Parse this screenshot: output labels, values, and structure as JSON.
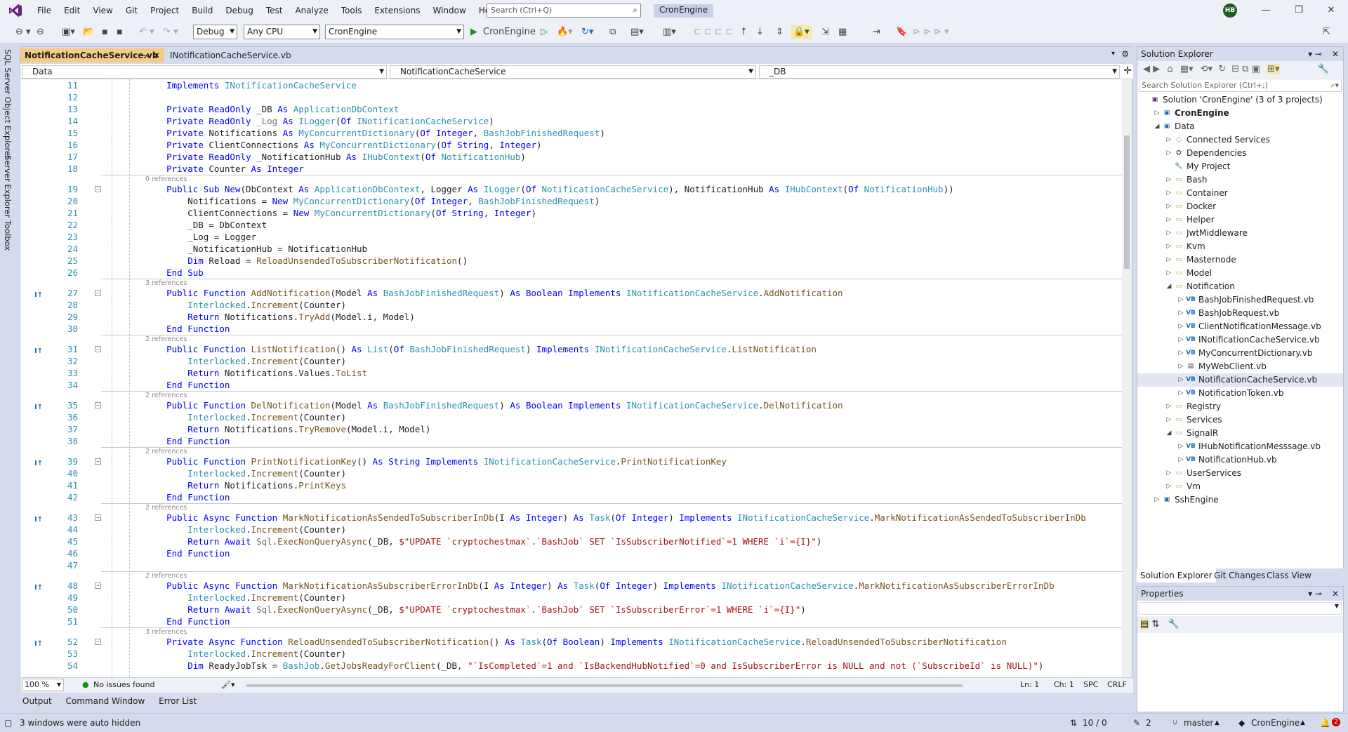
{
  "menu": [
    "File",
    "Edit",
    "View",
    "Git",
    "Project",
    "Build",
    "Debug",
    "Test",
    "Analyze",
    "Tools",
    "Extensions",
    "Window",
    "Help"
  ],
  "search": {
    "placeholder": "Search (Ctrl+Q)"
  },
  "solution_name": "CronEngine",
  "avatar": "HB",
  "toolbar": {
    "config": "Debug",
    "platform": "Any CPU",
    "startup": "CronEngine",
    "run_label": "CronEngine"
  },
  "side_tabs": [
    "SQL Server Object Explorer",
    "Server Explorer",
    "Toolbox"
  ],
  "doc_tabs": [
    {
      "label": "NotificationCacheService.vb",
      "active": true
    },
    {
      "label": "INotificationCacheService.vb",
      "active": false
    }
  ],
  "nav": {
    "project": "Data",
    "class": "NotificationCacheService",
    "member": "_DB"
  },
  "code_lines": [
    {
      "ln": "11",
      "ref": "",
      "html": "    <span class=kw>Implements</span> <span class=ty>INotificationCacheService</span>"
    },
    {
      "ln": "12",
      "ref": "",
      "html": ""
    },
    {
      "ln": "13",
      "ref": "",
      "html": "    <span class=kw>Private</span> <span class=kw>ReadOnly</span> _DB <span class=kw>As</span> <span class=ty>ApplicationDbContext</span>"
    },
    {
      "ln": "14",
      "ref": "",
      "html": "    <span class=kw>Private</span> <span class=kw>ReadOnly</span> <span class=gr>_Log</span> <span class=kw>As</span> <span class=ty>ILogger</span>(<span class=kw>Of</span> <span class=ty>INotificationCacheService</span>)"
    },
    {
      "ln": "15",
      "ref": "",
      "html": "    <span class=kw>Private</span> Notifications <span class=kw>As</span> <span class=ty>MyConcurrentDictionary</span>(<span class=kw>Of</span> <span class=kw>Integer</span>, <span class=ty>BashJobFinishedRequest</span>)"
    },
    {
      "ln": "16",
      "ref": "",
      "html": "    <span class=kw>Private</span> ClientConnections <span class=kw>As</span> <span class=ty>MyConcurrentDictionary</span>(<span class=kw>Of</span> <span class=kw>String</span>, <span class=kw>Integer</span>)"
    },
    {
      "ln": "17",
      "ref": "",
      "html": "    <span class=kw>Private</span> <span class=kw>ReadOnly</span> _NotificationHub <span class=kw>As</span> <span class=ty>IHubContext</span>(<span class=kw>Of</span> <span class=ty>NotificationHub</span>)"
    },
    {
      "ln": "18",
      "ref": "",
      "html": "    <span class=kw>Private</span> Counter <span class=kw>As</span> <span class=kw>Integer</span>"
    },
    {
      "ln": "19",
      "ref": "0 references",
      "html": "    <span class=kw>Public</span> <span class=kw>Sub</span> <span class=kw>New</span>(DbContext <span class=kw>As</span> <span class=ty>ApplicationDbContext</span>, Logger <span class=kw>As</span> <span class=ty>ILogger</span>(<span class=kw>Of</span> <span class=ty>NotificationCacheService</span>), NotificationHub <span class=kw>As</span> <span class=ty>IHubContext</span>(<span class=kw>Of</span> <span class=ty>NotificationHub</span>))"
    },
    {
      "ln": "20",
      "ref": "",
      "html": "        Notifications = <span class=kw>New</span> <span class=ty>MyConcurrentDictionary</span>(<span class=kw>Of</span> <span class=kw>Integer</span>, <span class=ty>BashJobFinishedRequest</span>)"
    },
    {
      "ln": "21",
      "ref": "",
      "html": "        ClientConnections = <span class=kw>New</span> <span class=ty>MyConcurrentDictionary</span>(<span class=kw>Of</span> <span class=kw>String</span>, <span class=kw>Integer</span>)"
    },
    {
      "ln": "22",
      "ref": "",
      "html": "        _DB = DbContext"
    },
    {
      "ln": "23",
      "ref": "",
      "html": "        _Log = Logger"
    },
    {
      "ln": "24",
      "ref": "",
      "html": "        _NotificationHub = NotificationHub"
    },
    {
      "ln": "25",
      "ref": "",
      "html": "        <span class=kw>Dim</span> Reload = <span class=mt>ReloadUnsendedToSubscriberNotification</span>()"
    },
    {
      "ln": "26",
      "ref": "",
      "html": "    <span class=kw>End</span> <span class=kw>Sub</span>"
    },
    {
      "ln": "27",
      "ref": "3 references",
      "html": "    <span class=kw>Public</span> <span class=kw>Function</span> <span class=mt>AddNotification</span>(Model <span class=kw>As</span> <span class=ty>BashJobFinishedRequest</span>) <span class=kw>As</span> <span class=kw>Boolean</span> <span class=kw>Implements</span> <span class=ty>INotificationCacheService</span>.<span class=mt>AddNotification</span>"
    },
    {
      "ln": "28",
      "ref": "",
      "html": "        <span class=ty>Interlocked</span>.<span class=mt>Increment</span>(Counter)"
    },
    {
      "ln": "29",
      "ref": "",
      "html": "        <span class=kw>Return</span> Notifications.<span class=mt>TryAdd</span>(Model.i, Model)"
    },
    {
      "ln": "30",
      "ref": "",
      "html": "    <span class=kw>End</span> <span class=kw>Function</span>"
    },
    {
      "ln": "31",
      "ref": "2 references",
      "html": "    <span class=kw>Public</span> <span class=kw>Function</span> <span class=mt>ListNotification</span>() <span class=kw>As</span> <span class=ty>List</span>(<span class=kw>Of</span> <span class=ty>BashJobFinishedRequest</span>) <span class=kw>Implements</span> <span class=ty>INotificationCacheService</span>.<span class=mt>ListNotification</span>"
    },
    {
      "ln": "32",
      "ref": "",
      "html": "        <span class=ty>Interlocked</span>.<span class=mt>Increment</span>(Counter)"
    },
    {
      "ln": "33",
      "ref": "",
      "html": "        <span class=kw>Return</span> Notifications.Values.<span class=mt>ToList</span>"
    },
    {
      "ln": "34",
      "ref": "",
      "html": "    <span class=kw>End</span> <span class=kw>Function</span>"
    },
    {
      "ln": "35",
      "ref": "2 references",
      "html": "    <span class=kw>Public</span> <span class=kw>Function</span> <span class=mt>DelNotification</span>(Model <span class=kw>As</span> <span class=ty>BashJobFinishedRequest</span>) <span class=kw>As</span> <span class=kw>Boolean</span> <span class=kw>Implements</span> <span class=ty>INotificationCacheService</span>.<span class=mt>DelNotification</span>"
    },
    {
      "ln": "36",
      "ref": "",
      "html": "        <span class=ty>Interlocked</span>.<span class=mt>Increment</span>(Counter)"
    },
    {
      "ln": "37",
      "ref": "",
      "html": "        <span class=kw>Return</span> Notifications.<span class=mt>TryRemove</span>(Model.i, Model)"
    },
    {
      "ln": "38",
      "ref": "",
      "html": "    <span class=kw>End</span> <span class=kw>Function</span>"
    },
    {
      "ln": "39",
      "ref": "2 references",
      "html": "    <span class=kw>Public</span> <span class=kw>Function</span> <span class=mt>PrintNotificationKey</span>() <span class=kw>As</span> <span class=kw>String</span> <span class=kw>Implements</span> <span class=ty>INotificationCacheService</span>.<span class=mt>PrintNotificationKey</span>"
    },
    {
      "ln": "40",
      "ref": "",
      "html": "        <span class=ty>Interlocked</span>.<span class=mt>Increment</span>(Counter)"
    },
    {
      "ln": "41",
      "ref": "",
      "html": "        <span class=kw>Return</span> Notifications.<span class=mt>PrintKeys</span>"
    },
    {
      "ln": "42",
      "ref": "",
      "html": "    <span class=kw>End</span> <span class=kw>Function</span>"
    },
    {
      "ln": "43",
      "ref": "2 references",
      "html": "    <span class=kw>Public</span> <span class=kw>Async</span> <span class=kw>Function</span> <span class=mt>MarkNotificationAsSendedToSubscriberInDb</span>(I <span class=kw>As</span> <span class=kw>Integer</span>) <span class=kw>As</span> <span class=ty>Task</span>(<span class=kw>Of</span> <span class=kw>Integer</span>) <span class=kw>Implements</span> <span class=ty>INotificationCacheService</span>.<span class=mt>MarkNotificationAsSendedToSubscriberInDb</span>"
    },
    {
      "ln": "44",
      "ref": "",
      "html": "        <span class=ty>Interlocked</span>.<span class=mt>Increment</span>(Counter)"
    },
    {
      "ln": "45",
      "ref": "",
      "html": "        <span class=kw>Return</span> <span class=kw>Await</span> <span class=gr>Sql</span>.<span class=mt>ExecNonQueryAsync</span>(_DB, <span class=st>$\"UPDATE `cryptochestmax`.`BashJob` SET `IsSubscriberNotified`=1 WHERE `i`={I}\"</span>)"
    },
    {
      "ln": "46",
      "ref": "",
      "html": "    <span class=kw>End</span> <span class=kw>Function</span>"
    },
    {
      "ln": "47",
      "ref": "",
      "html": ""
    },
    {
      "ln": "48",
      "ref": "2 references",
      "html": "    <span class=kw>Public</span> <span class=kw>Async</span> <span class=kw>Function</span> <span class=mt>MarkNotificationAsSubscriberErrorInDb</span>(I <span class=kw>As</span> <span class=kw>Integer</span>) <span class=kw>As</span> <span class=ty>Task</span>(<span class=kw>Of</span> <span class=kw>Integer</span>) <span class=kw>Implements</span> <span class=ty>INotificationCacheService</span>.<span class=mt>MarkNotificationAsSubscriberErrorInDb</span>"
    },
    {
      "ln": "49",
      "ref": "",
      "html": "        <span class=ty>Interlocked</span>.<span class=mt>Increment</span>(Counter)"
    },
    {
      "ln": "50",
      "ref": "",
      "html": "        <span class=kw>Return</span> <span class=kw>Await</span> <span class=gr>Sql</span>.<span class=mt>ExecNonQueryAsync</span>(_DB, <span class=st>$\"UPDATE `cryptochestmax`.`BashJob` SET `IsSubscriberError`=1 WHERE `i`={I}\"</span>)"
    },
    {
      "ln": "51",
      "ref": "",
      "html": "    <span class=kw>End</span> <span class=kw>Function</span>"
    },
    {
      "ln": "52",
      "ref": "3 references",
      "html": "    <span class=kw>Private</span> <span class=kw>Async</span> <span class=kw>Function</span> <span class=mt>ReloadUnsendedToSubscriberNotification</span>() <span class=kw>As</span> <span class=ty>Task</span>(<span class=kw>Of</span> <span class=kw>Boolean</span>) <span class=kw>Implements</span> <span class=ty>INotificationCacheService</span>.<span class=mt>ReloadUnsendedToSubscriberNotification</span>"
    },
    {
      "ln": "53",
      "ref": "",
      "html": "        <span class=ty>Interlocked</span>.<span class=mt>Increment</span>(Counter)"
    },
    {
      "ln": "54",
      "ref": "",
      "html": "        <span class=kw>Dim</span> ReadyJobTsk = <span class=ty>BashJob</span>.<span class=mt>GetJobsReadyForClient</span>(_DB, <span class=st>\"`IsCompleted`=1 and `IsBackendHubNotified`=0 and IsSubscriberError is NULL and not (`SubscribeId` is NULL)\"</span>)"
    }
  ],
  "editor_status": {
    "zoom": "100 %",
    "issues": "No issues found",
    "ln": "Ln: 1",
    "ch": "Ch: 1",
    "spc": "SPC",
    "crlf": "CRLF"
  },
  "bottom_tabs": [
    "Output",
    "Command Window",
    "Error List"
  ],
  "statusbar": {
    "left": "3 windows were auto hidden",
    "updown": "10 / 0",
    "pencil": "2",
    "branch": "master",
    "repo": "CronEngine",
    "bell": "2"
  },
  "solution_explorer": {
    "title": "Solution Explorer",
    "search_placeholder": "Search Solution Explorer (Ctrl+;)",
    "items": [
      {
        "label": "Solution 'CronEngine' (3 of 3 projects)",
        "level": 0,
        "exp": "",
        "icon": "sln"
      },
      {
        "label": "CronEngine",
        "level": 1,
        "exp": "▷",
        "icon": "proj",
        "bold": true
      },
      {
        "label": "Data",
        "level": 1,
        "exp": "◢",
        "icon": "proj"
      },
      {
        "label": "Connected Services",
        "level": 2,
        "exp": "▷",
        "icon": "svc"
      },
      {
        "label": "Dependencies",
        "level": 2,
        "exp": "▷",
        "icon": "dep"
      },
      {
        "label": "My Project",
        "level": 2,
        "exp": "",
        "icon": "wrench"
      },
      {
        "label": "Bash",
        "level": 2,
        "exp": "▷",
        "icon": "folder"
      },
      {
        "label": "Container",
        "level": 2,
        "exp": "▷",
        "icon": "folder"
      },
      {
        "label": "Docker",
        "level": 2,
        "exp": "▷",
        "icon": "folder"
      },
      {
        "label": "Helper",
        "level": 2,
        "exp": "▷",
        "icon": "folder"
      },
      {
        "label": "JwtMiddleware",
        "level": 2,
        "exp": "▷",
        "icon": "folder"
      },
      {
        "label": "Kvm",
        "level": 2,
        "exp": "▷",
        "icon": "folder"
      },
      {
        "label": "Masternode",
        "level": 2,
        "exp": "▷",
        "icon": "folder"
      },
      {
        "label": "Model",
        "level": 2,
        "exp": "▷",
        "icon": "folder"
      },
      {
        "label": "Notification",
        "level": 2,
        "exp": "◢",
        "icon": "folder-open"
      },
      {
        "label": "BashJobFinishedRequest.vb",
        "level": 3,
        "exp": "▷",
        "icon": "vb"
      },
      {
        "label": "BashJobRequest.vb",
        "level": 3,
        "exp": "▷",
        "icon": "vb"
      },
      {
        "label": "ClientNotificationMessage.vb",
        "level": 3,
        "exp": "▷",
        "icon": "vb"
      },
      {
        "label": "INotificationCacheService.vb",
        "level": 3,
        "exp": "▷",
        "icon": "vb"
      },
      {
        "label": "MyConcurrentDictionary.vb",
        "level": 3,
        "exp": "▷",
        "icon": "vb"
      },
      {
        "label": "MyWebClient.vb",
        "level": 3,
        "exp": "▷",
        "icon": "file"
      },
      {
        "label": "NotificationCacheService.vb",
        "level": 3,
        "exp": "▷",
        "icon": "vb",
        "selected": true
      },
      {
        "label": "NotificationToken.vb",
        "level": 3,
        "exp": "▷",
        "icon": "vb"
      },
      {
        "label": "Registry",
        "level": 2,
        "exp": "▷",
        "icon": "folder"
      },
      {
        "label": "Services",
        "level": 2,
        "exp": "▷",
        "icon": "folder"
      },
      {
        "label": "SignalR",
        "level": 2,
        "exp": "◢",
        "icon": "folder-open"
      },
      {
        "label": "IHubNotificationMesssage.vb",
        "level": 3,
        "exp": "▷",
        "icon": "vb"
      },
      {
        "label": "NotificationHub.vb",
        "level": 3,
        "exp": "▷",
        "icon": "vb"
      },
      {
        "label": "UserServices",
        "level": 2,
        "exp": "▷",
        "icon": "folder"
      },
      {
        "label": "Vm",
        "level": 2,
        "exp": "▷",
        "icon": "folder"
      },
      {
        "label": "SshEngine",
        "level": 1,
        "exp": "▷",
        "icon": "proj"
      }
    ],
    "tabs": [
      "Solution Explorer",
      "Git Changes",
      "Class View"
    ]
  },
  "properties": {
    "title": "Properties"
  },
  "colors": {
    "accent": "#68217a",
    "keyword": "#0000ff",
    "type": "#2b91af",
    "string": "#a31515",
    "linenum": "#2b91af"
  }
}
